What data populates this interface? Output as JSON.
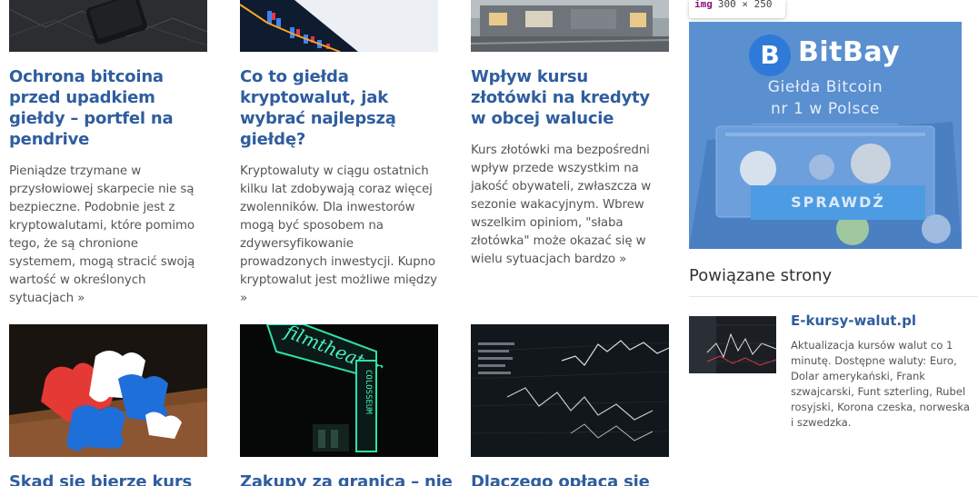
{
  "articles": [
    {
      "title": "Ochrona bitcoina przed upadkiem giełdy – portfel na pendrive",
      "excerpt": "Pieniądze trzymane w przysłowiowej skarpecie nie są bezpieczne. Podobnie jest z kryptowalutami, które pomimo tego, że są chronione systemem, mogą stracić swoją wartość w określonych sytuacjach »"
    },
    {
      "title": "Co to giełda kryptowalut, jak wybrać najlepszą giełdę?",
      "excerpt": "Kryptowaluty w ciągu ostatnich kilku lat zdobywają coraz więcej zwolenników. Dla inwestorów mogą być sposobem na zdywersyfikowanie prowadzonych inwestycji. Kupno kryptowalut jest możliwe między »"
    },
    {
      "title": "Wpływ kursu złotówki na kredyty w obcej walucie",
      "excerpt": "Kurs złotówki ma bezpośredni wpływ przede wszystkim na jakość obywateli, zwłaszcza w sezonie wakacyjnym. Wbrew wszelkim opiniom, \"słaba złotówka\" może okazać się w wielu sytuacjach bardzo »"
    },
    {
      "title": "Skąd się bierze kurs"
    },
    {
      "title": "Zakupy za granicą – nie"
    },
    {
      "title": "Dlaczego opłaca się"
    }
  ],
  "ad": {
    "tag_name": "img",
    "tag_dims": "300 × 250",
    "brand": "BitBay",
    "logo_letter": "B",
    "line1": "Giełda Bitcoin",
    "line2": "nr 1 w Polsce",
    "button": "SPRAWDŹ",
    "colors": {
      "background": "#5a8fd0",
      "button": "#4d9be3",
      "logo": "#2f7ad8"
    }
  },
  "sidebar": {
    "heading": "Powiązane strony",
    "related": {
      "title": "E-kursy-walut.pl",
      "description": "Aktualizacja kursów walut co 1 minutę. Dostępne waluty: Euro, Dolar amerykański, Frank szwajcarski, Funt szterling, Rubel rosyjski, Korona czeska, norweska i szwedzka."
    }
  },
  "colors": {
    "link": "#2f5d9e",
    "text": "#555555"
  }
}
